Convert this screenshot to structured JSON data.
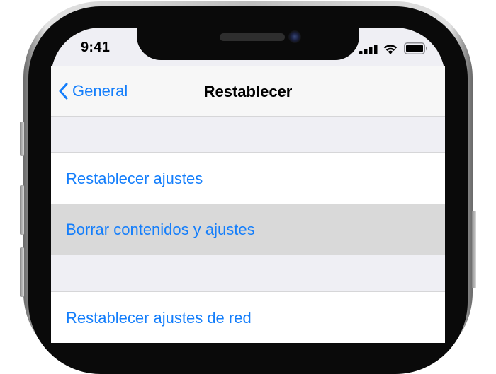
{
  "status": {
    "time": "9:41"
  },
  "nav": {
    "back_label": "General",
    "title": "Restablecer"
  },
  "section1": {
    "items": [
      {
        "label": "Restablecer ajustes",
        "selected": false
      },
      {
        "label": "Borrar contenidos y ajustes",
        "selected": true
      }
    ]
  },
  "section2": {
    "items": [
      {
        "label": "Restablecer ajustes de red",
        "selected": false
      }
    ]
  },
  "colors": {
    "accent": "#147efb",
    "selected_row": "#d9d9d9",
    "group_bg": "#efeff4"
  },
  "icons": [
    "chevron-left-icon",
    "cellular-signal-icon",
    "wifi-icon",
    "battery-icon"
  ]
}
